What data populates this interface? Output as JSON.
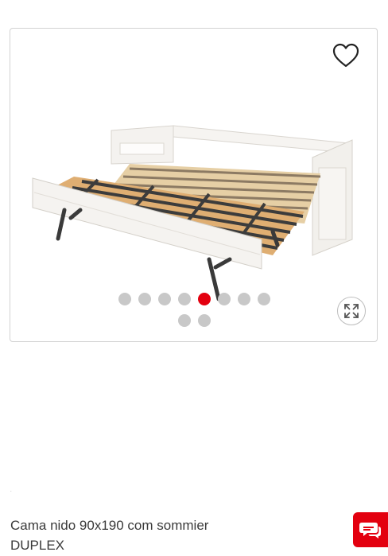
{
  "product": {
    "title_line1": "Cama nido 90x190 com sommier",
    "title_line2": "DUPLEX",
    "stray_mark": "."
  },
  "gallery": {
    "image_count": 10,
    "active_index": 4,
    "image_subject": "bed-image",
    "favorite_icon": "heart-outline-icon",
    "zoom_icon": "expand-arrows-icon"
  },
  "chat": {
    "icon": "chat-bubbles-icon"
  },
  "colors": {
    "accent": "#e3000f",
    "dot_inactive": "#c8c8c8",
    "border": "#d2d2d2",
    "text": "#3a3a3a"
  }
}
